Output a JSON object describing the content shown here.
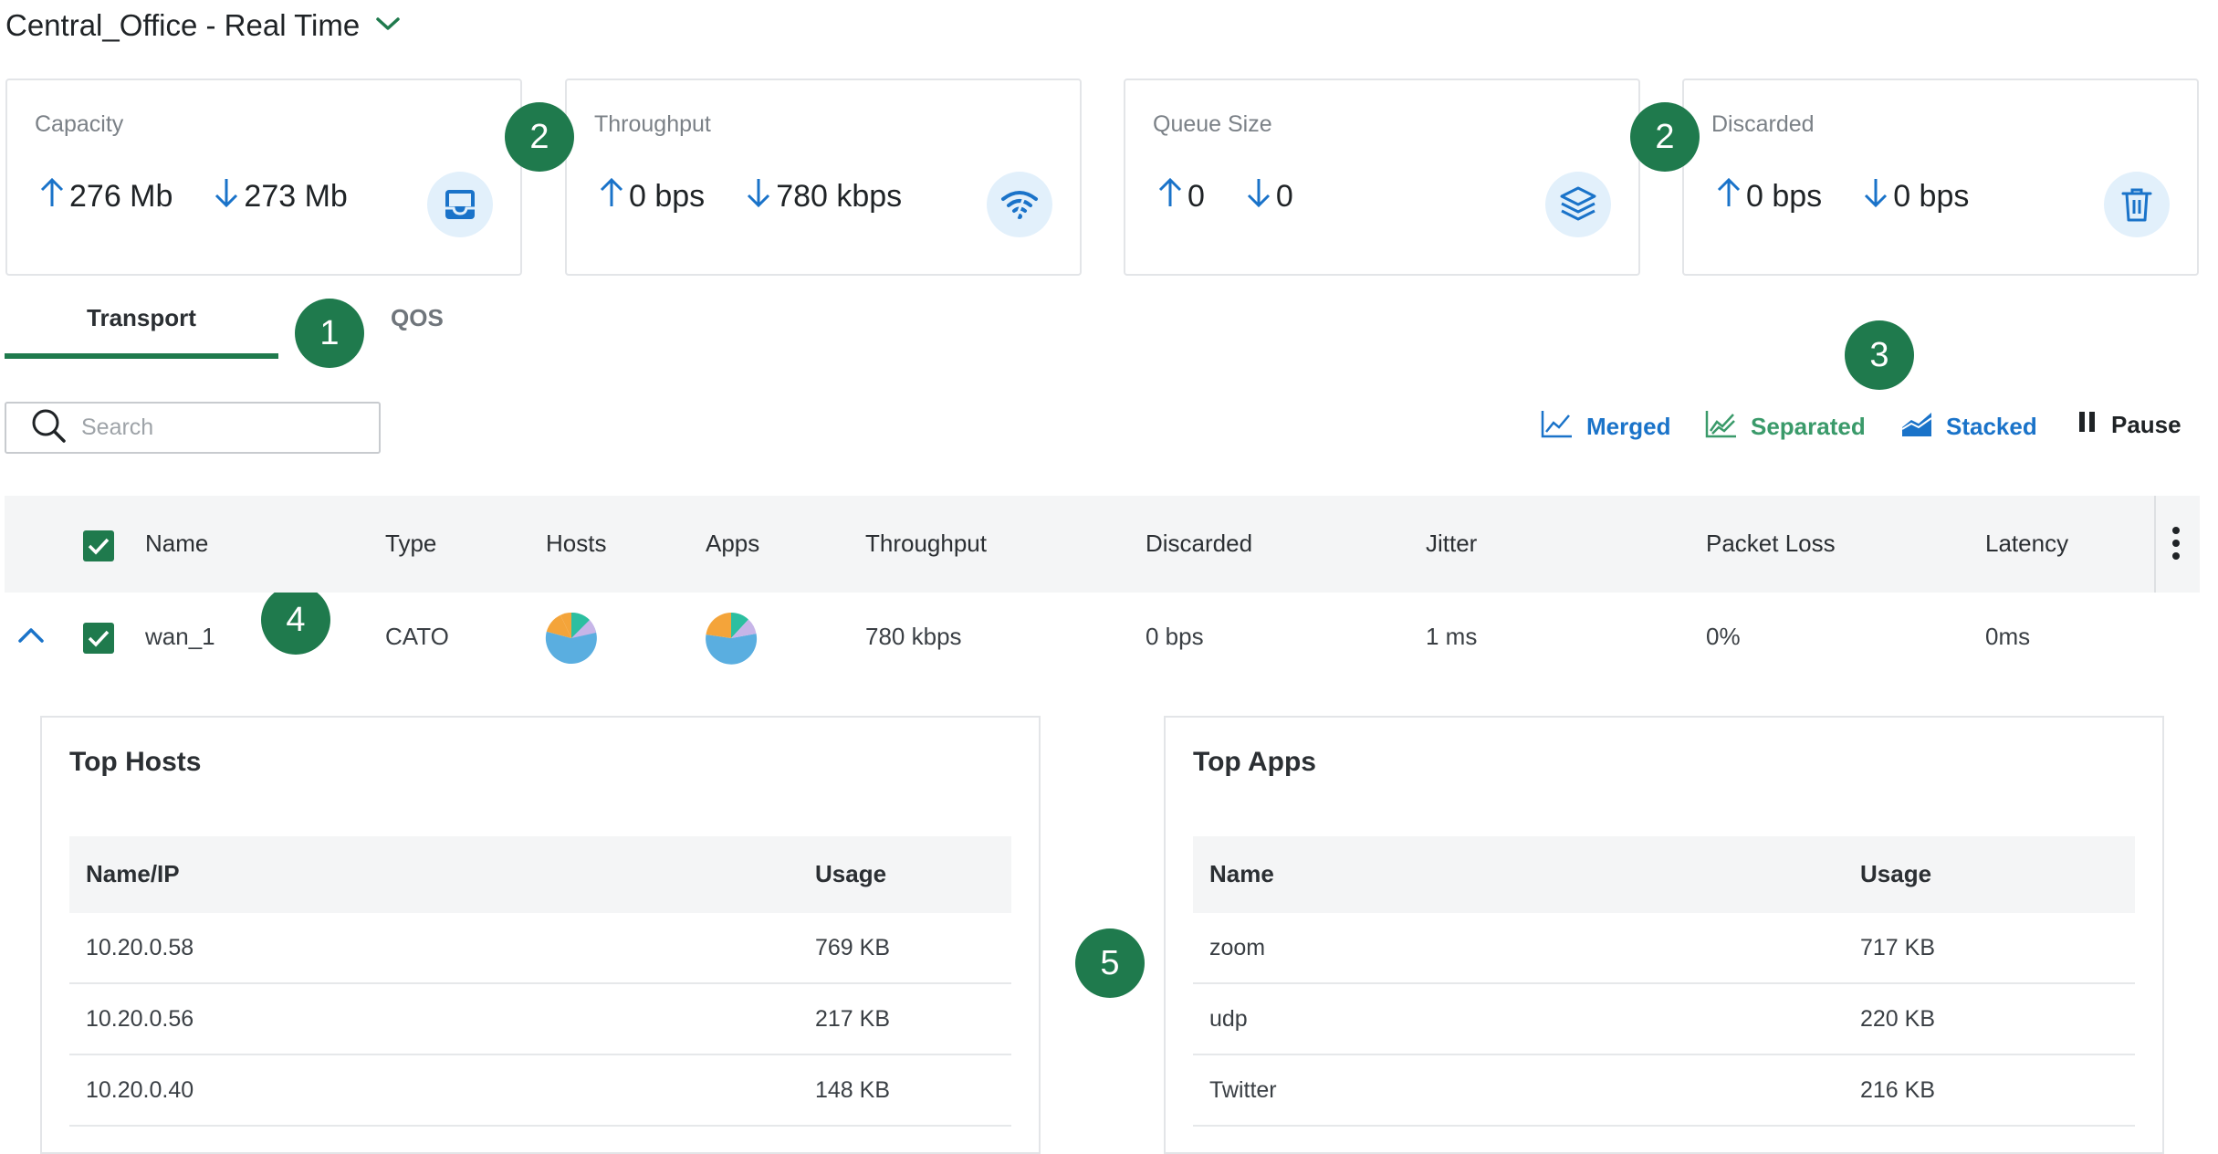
{
  "header": {
    "title": "Central_Office - Real Time"
  },
  "cards": [
    {
      "label": "Capacity",
      "up": "276 Mb",
      "down": "273 Mb",
      "icon": "inbox-icon"
    },
    {
      "label": "Throughput",
      "up": "0 bps",
      "down": "780 kbps",
      "icon": "signal-icon"
    },
    {
      "label": "Queue Size",
      "up": "0",
      "down": "0",
      "icon": "layers-icon"
    },
    {
      "label": "Discarded",
      "up": "0 bps",
      "down": "0 bps",
      "icon": "trash-icon"
    }
  ],
  "badges": [
    "2",
    "2",
    "1",
    "3",
    "4",
    "5"
  ],
  "tabs": {
    "transport": "Transport",
    "qos": "QOS"
  },
  "search": {
    "placeholder": "Search"
  },
  "modes": {
    "merged": "Merged",
    "separated": "Separated",
    "stacked": "Stacked",
    "pause": "Pause"
  },
  "colors": {
    "accent": "#1f7a4d",
    "blue": "#1a73c9",
    "green": "#3a9a6a",
    "iconbg": "#e2f0fb"
  },
  "table": {
    "headers": {
      "name": "Name",
      "type": "Type",
      "hosts": "Hosts",
      "apps": "Apps",
      "throughput": "Throughput",
      "discarded": "Discarded",
      "jitter": "Jitter",
      "packet_loss": "Packet Loss",
      "latency": "Latency"
    },
    "row": {
      "name": "wan_1",
      "type": "CATO",
      "throughput": "780 kbps",
      "discarded": "0 bps",
      "jitter": "1 ms",
      "packet_loss": "0%",
      "latency": "0ms"
    }
  },
  "top_hosts": {
    "title": "Top Hosts",
    "col_name": "Name/IP",
    "col_usage": "Usage",
    "rows": [
      {
        "name": "10.20.0.58",
        "usage": "769 KB"
      },
      {
        "name": "10.20.0.56",
        "usage": "217 KB"
      },
      {
        "name": "10.20.0.40",
        "usage": "148 KB"
      }
    ]
  },
  "top_apps": {
    "title": "Top Apps",
    "col_name": "Name",
    "col_usage": "Usage",
    "rows": [
      {
        "name": "zoom",
        "usage": "717 KB"
      },
      {
        "name": "udp",
        "usage": "220 KB"
      },
      {
        "name": "Twitter",
        "usage": "216 KB"
      }
    ]
  }
}
